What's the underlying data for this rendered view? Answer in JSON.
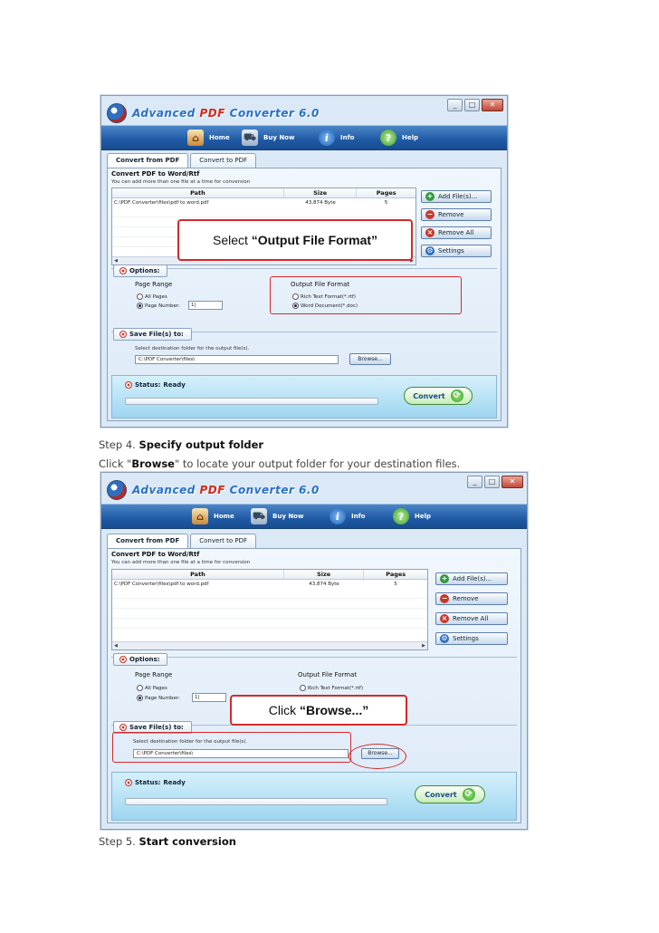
{
  "app": {
    "title_part1": "Advanced ",
    "title_pdf": "PDF",
    "title_part2": " Converter 6.0",
    "window_buttons": {
      "minimize": "_",
      "maximize": "□",
      "close": "✕"
    },
    "nav": [
      {
        "label": "Home",
        "icon": "home-icon"
      },
      {
        "label": "Buy Now",
        "icon": "cart-icon"
      },
      {
        "label": "Info",
        "icon": "info-icon"
      },
      {
        "label": "Help",
        "icon": "help-icon"
      }
    ],
    "tabs": [
      "Convert from PDF",
      "Convert to PDF"
    ],
    "heading": "Convert PDF to Word/Rtf",
    "note": "You can add more than one file at a time for conversion",
    "columns": [
      "Path",
      "Size",
      "Pages"
    ],
    "rows": [
      {
        "path": "C:\\PDF Converter\\files\\pdf to word.pdf",
        "size": "43,874 Byte",
        "pages": "5"
      }
    ],
    "side_buttons": [
      "Add File(s)...",
      "Remove",
      "Remove All",
      "Settings"
    ],
    "options_label": "Options:",
    "page_range_label": "Page Range",
    "all_pages": "All Pages",
    "page_number": "Page Number:",
    "page_number_value": "1|",
    "output_format_label": "Output File Format",
    "rich_text": "Rich Text Format(*.rtf)",
    "word_doc": "Word Document(*.doc)",
    "save_label": "Save File(s) to:",
    "dest_note": "Select destination folder for the output file(s).",
    "dest_path": "C:\\PDF Converter\\files\\",
    "browse": "Browse...",
    "status_label": "Status:",
    "status_value": "Ready",
    "convert": "Convert"
  },
  "callout1": {
    "prefix": "Select ",
    "bold": "“Output File Format”"
  },
  "callout2": {
    "prefix": "Click ",
    "bold": "“Browse...”"
  },
  "step4": {
    "prefix": "Step 4. ",
    "title": "Specify output folder"
  },
  "step4_desc": {
    "p1": "Click \"",
    "bold": "Browse",
    "p2": "\" to locate your output folder for your destination files."
  },
  "step5": {
    "prefix": "Step 5. ",
    "title": "Start conversion"
  }
}
